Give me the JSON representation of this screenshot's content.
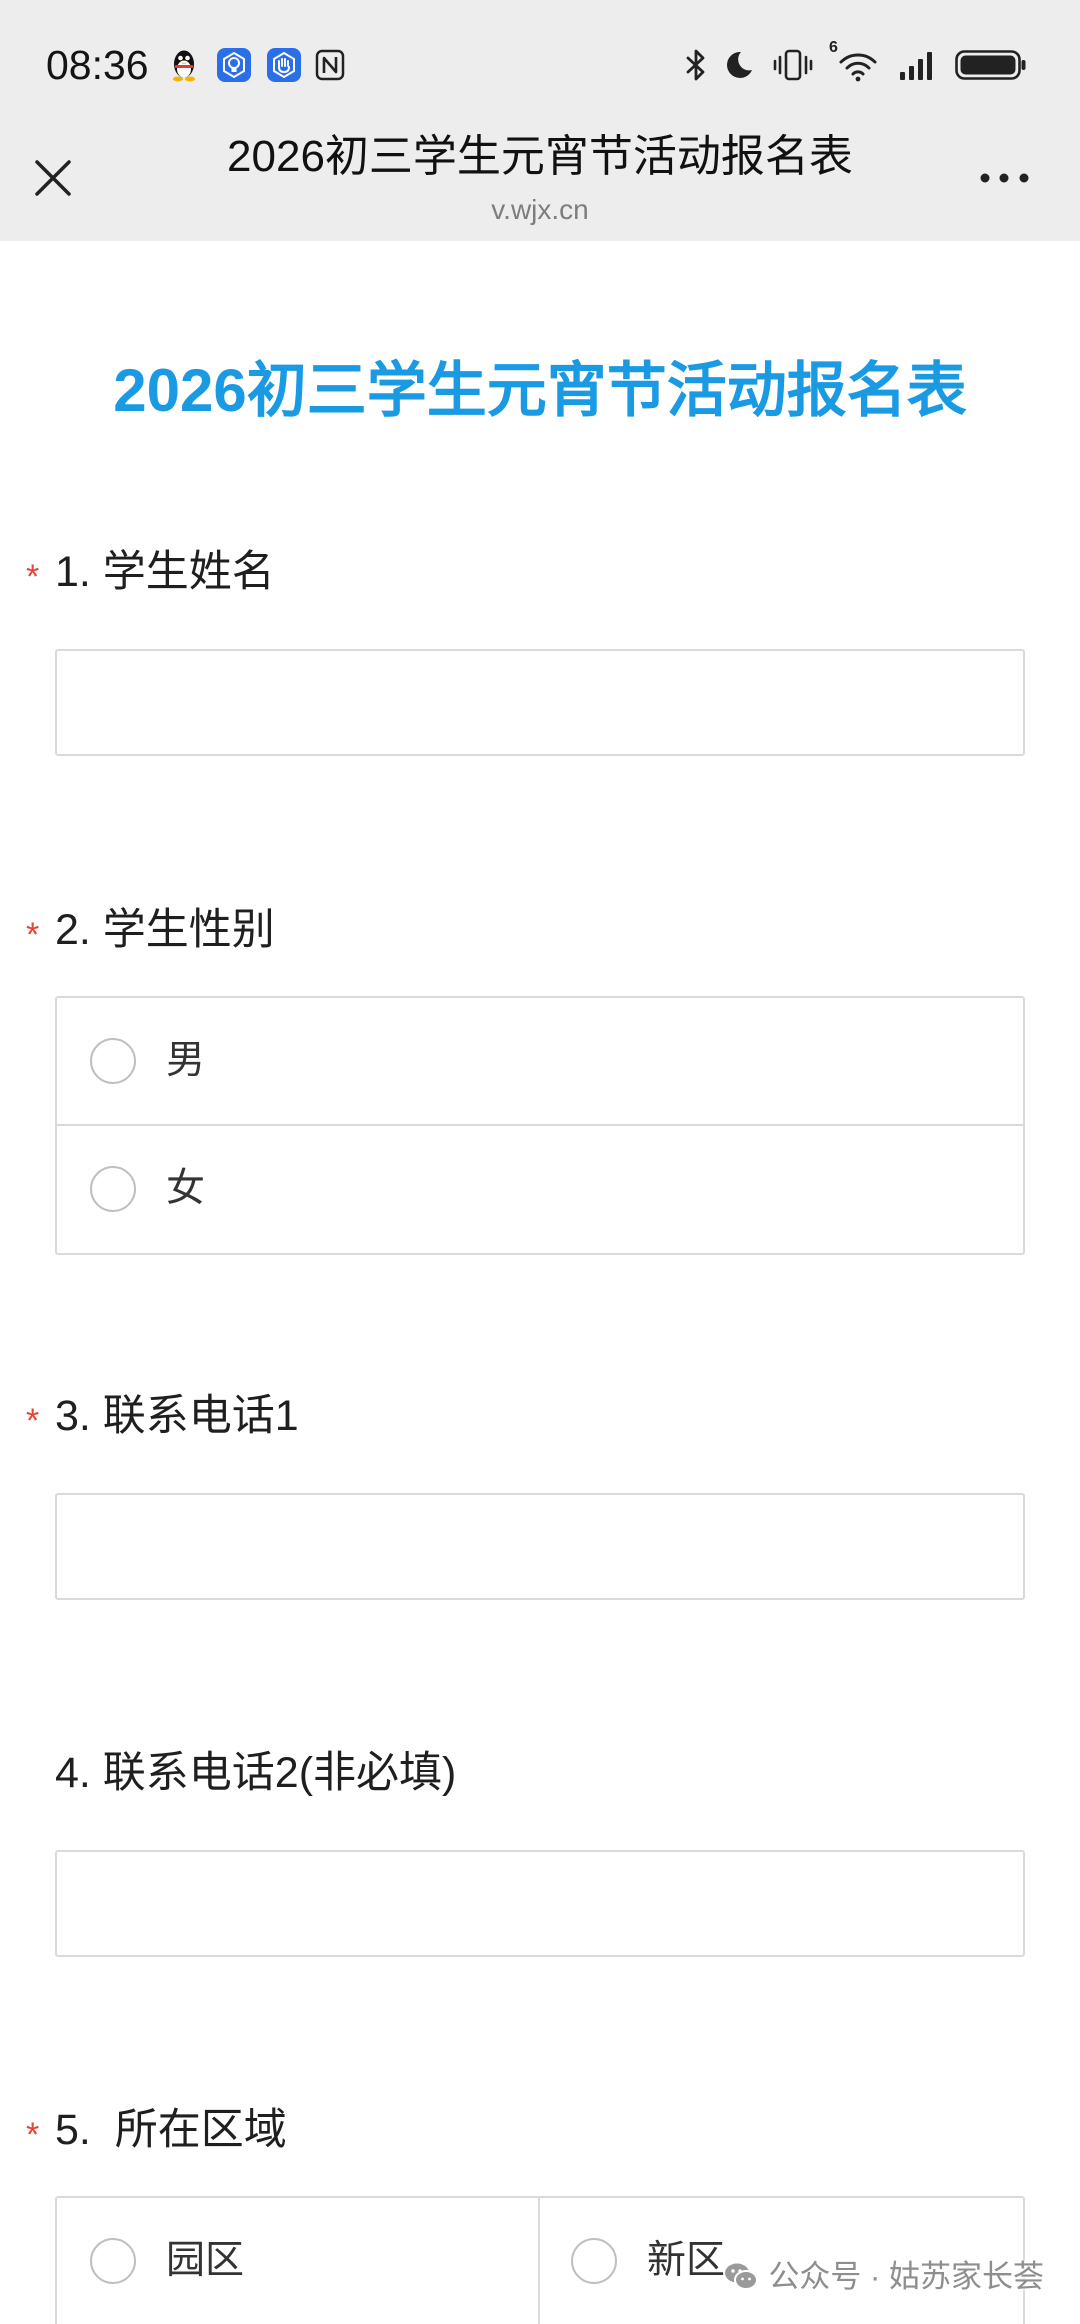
{
  "status_bar": {
    "time": "08:36",
    "wifi_label": "6",
    "left_icons": [
      "qq-icon",
      "app-bulb-icon",
      "app-hand-icon",
      "nfc-icon"
    ],
    "right_icons": [
      "bluetooth-icon",
      "moon-icon",
      "vibrate-icon",
      "wifi-icon",
      "signal-icon",
      "battery-icon"
    ]
  },
  "header": {
    "title": "2026初三学生元宵节活动报名表",
    "url": "v.wjx.cn",
    "left_icon": "close-icon",
    "right_icon": "more-icon"
  },
  "form": {
    "title": "2026初三学生元宵节活动报名表",
    "required_mark": "*",
    "questions": [
      {
        "label": "1. 学生姓名",
        "required": true,
        "value": ""
      },
      {
        "label": "2. 学生性别",
        "required": true,
        "options": [
          "男",
          "女"
        ],
        "selected": null
      },
      {
        "label": "3. 联系电话1",
        "required": true,
        "value": ""
      },
      {
        "label": "4. 联系电话2(非必填)",
        "required": false,
        "value": ""
      },
      {
        "label": "5.  所在区域",
        "required": true,
        "options": [
          "园区",
          "新区"
        ],
        "selected": null
      }
    ]
  },
  "watermark": {
    "icon": "wechat-icon",
    "text": "公众号 · 姑苏家长荟"
  },
  "colors": {
    "topbar_bg": "#ededed",
    "form_title": "#1b9ae4",
    "required_mark": "#e0453a",
    "field_border": "#dadada",
    "app_icon_blue": "#2a6ee8"
  }
}
